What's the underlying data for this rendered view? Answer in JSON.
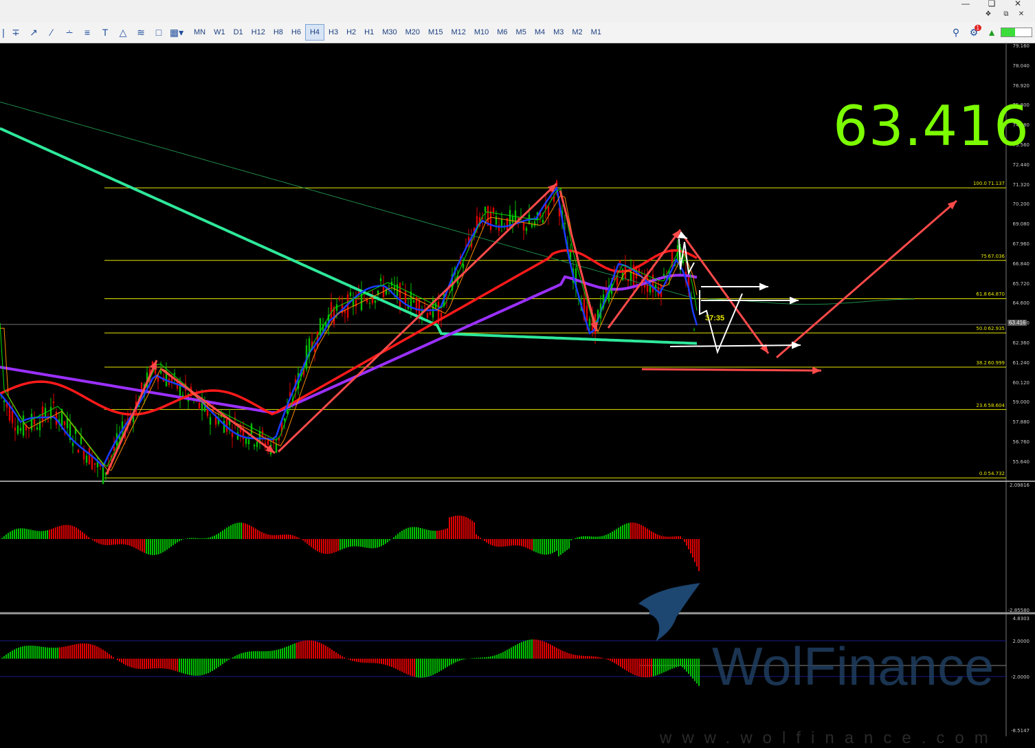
{
  "toolbar": {
    "timeframes": [
      "MN",
      "W1",
      "D1",
      "H12",
      "H8",
      "H6",
      "H4",
      "H3",
      "H2",
      "H1",
      "M30",
      "M20",
      "M15",
      "M12",
      "M10",
      "M6",
      "M5",
      "M4",
      "M3",
      "M2",
      "M1"
    ],
    "active_timeframe": "H4",
    "notification_count": "1",
    "tools": [
      "cursor-icon",
      "crosshair-icon",
      "trendline-icon",
      "ray-icon",
      "channel-icon",
      "fibonacci-icon",
      "text-icon",
      "shapes-icon",
      "gann-icon",
      "rectangle-icon",
      "objects-menu-icon"
    ]
  },
  "price_axis": {
    "labels": [
      "79.160",
      "78.040",
      "76.920",
      "75.800",
      "74.680",
      "73.560",
      "72.440",
      "71.320",
      "70.200",
      "69.080",
      "67.960",
      "66.840",
      "65.720",
      "64.600",
      "63.480",
      "62.360",
      "61.240",
      "60.120",
      "59.000",
      "57.880",
      "56.760",
      "55.640"
    ],
    "current": "63.416"
  },
  "big_price": "63.416",
  "fibonacci": [
    {
      "level": "100.0",
      "price": "71.137"
    },
    {
      "level": "75",
      "price": "67.036"
    },
    {
      "level": "61.8",
      "price": "64.870"
    },
    {
      "level": "50.0",
      "price": "62.935"
    },
    {
      "level": "38.2",
      "price": "60.999"
    },
    {
      "level": "23.6",
      "price": "58.604"
    },
    {
      "level": "0.0",
      "price": "54.732"
    }
  ],
  "countdown": "37:35",
  "indicator1_axis": {
    "top": "2.09816",
    "bottom": "-2.85580"
  },
  "indicator2_axis": {
    "top": "4.8303",
    "mid_top": "2.0000",
    "mid_bottom": "-2.0000",
    "bottom": "-8.5147"
  },
  "watermark": {
    "name": "WolFinance",
    "url": "www.wolfinance.com"
  },
  "colors": {
    "up": "#00c000",
    "down": "#e00000",
    "arrow": "#ff4a4a",
    "fib": "#e8e800",
    "ema_green": "#2ee89a",
    "ma_purple": "#9b30ff",
    "ma_blue": "#1a3cff",
    "ma_red": "#ff1a1a",
    "big_price": "#7cfc00"
  }
}
